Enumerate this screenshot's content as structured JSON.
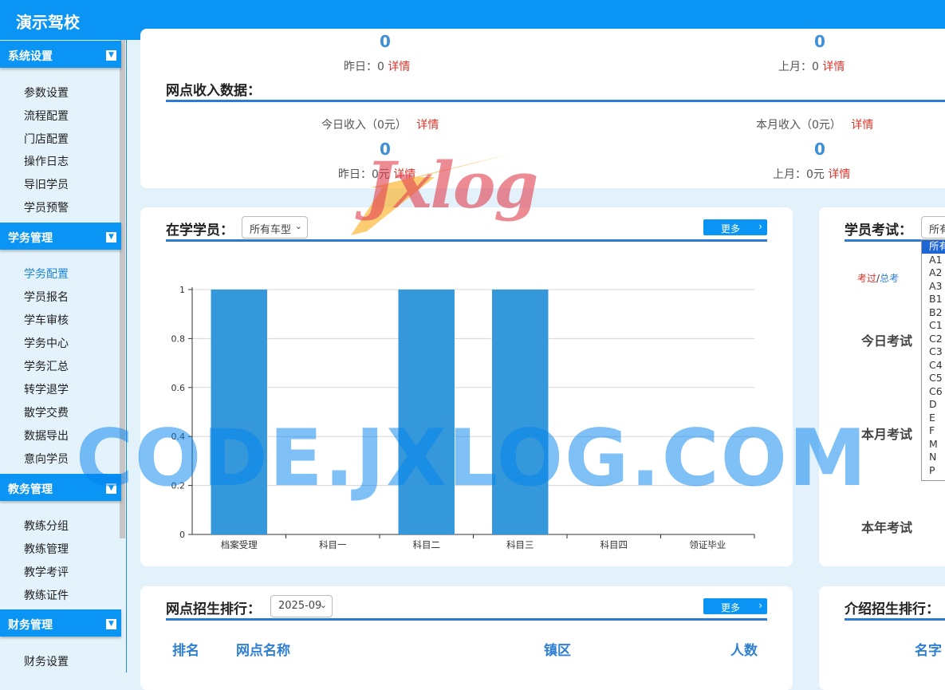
{
  "app": {
    "title": "演示驾校"
  },
  "sidebar": {
    "groups": [
      {
        "label": "系统设置",
        "items": [
          "参数设置",
          "流程配置",
          "门店配置",
          "操作日志",
          "导旧学员",
          "学员预警"
        ]
      },
      {
        "label": "学务管理",
        "items": [
          "学务配置",
          "学员报名",
          "学车审核",
          "学务中心",
          "学务汇总",
          "转学退学",
          "散学交费",
          "数据导出",
          "意向学员"
        ]
      },
      {
        "label": "教务管理",
        "items": [
          "教练分组",
          "教练管理",
          "教学考评",
          "教练证件"
        ]
      },
      {
        "label": "财务管理",
        "items": [
          "财务设置"
        ]
      }
    ]
  },
  "top_stats": {
    "left": {
      "value": "0",
      "yesterday": "昨日：0",
      "detail": "详情"
    },
    "right": {
      "value": "0",
      "last_month": "上月：0",
      "detail": "详情"
    }
  },
  "income": {
    "title": "网点收入数据：",
    "today": {
      "label": "今日收入（0元）",
      "detail": "详情",
      "value": "0",
      "yesterday": "昨日：0元",
      "detail2": "详情"
    },
    "month": {
      "label": "本月收入（0元）",
      "detail": "详情",
      "value": "0",
      "last_month": "上月：0元",
      "detail2": "详情"
    }
  },
  "students": {
    "title": "在学学员：",
    "select": "所有车型",
    "more": "更多"
  },
  "chart_data": {
    "type": "bar",
    "categories": [
      "档案受理",
      "科目一",
      "科目二",
      "科目三",
      "科目四",
      "领证毕业"
    ],
    "values": [
      1,
      0,
      1,
      1,
      0,
      0
    ],
    "ylim": [
      0,
      1
    ],
    "yticks": [
      "0",
      "0.2",
      "0.4",
      "0.6",
      "0.8",
      "1"
    ],
    "grid": true,
    "bar_color": "#3498db"
  },
  "exams": {
    "title": "学员考试：",
    "select": "所有",
    "pass_label": "考过",
    "slash": "/",
    "total_label": "总考",
    "rows": [
      "今日考试",
      "本月考试",
      "本年考试"
    ],
    "dropdown_options": [
      "所有",
      "A1",
      "A2",
      "A3",
      "B1",
      "B2",
      "C1",
      "C2",
      "C3",
      "C4",
      "C5",
      "C6",
      "D",
      "E",
      "F",
      "M",
      "N",
      "P"
    ]
  },
  "branch_rank": {
    "title": "网点招生排行：",
    "select": "2025-09",
    "more": "更多",
    "columns": [
      "排名",
      "网点名称",
      "镇区",
      "人数"
    ]
  },
  "intro_rank": {
    "title": "介绍招生排行：",
    "columns": [
      "名字"
    ]
  },
  "overlays": {
    "logo_text": "Jxlog",
    "watermark": "CODE.JXLOG.COM"
  },
  "colors": {
    "primary": "#0a95f4",
    "accent_blue": "#2b7bd6",
    "link_red": "#d9342b"
  }
}
